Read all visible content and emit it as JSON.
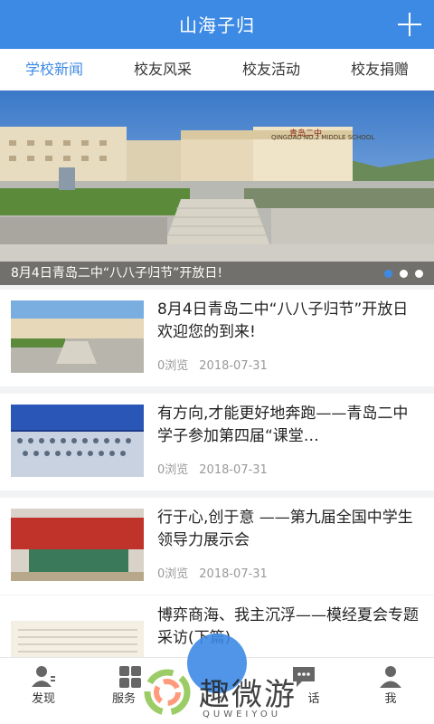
{
  "header": {
    "title": "山海子归"
  },
  "tabs": [
    {
      "label": "学校新闻"
    },
    {
      "label": "校友风采"
    },
    {
      "label": "校友活动"
    },
    {
      "label": "校友捐赠"
    }
  ],
  "banner": {
    "caption": "8月4日青岛二中“八八子归节”开放日!",
    "sign_text": "青岛二中",
    "sign_subtext": "QINGDAO NO.2 MIDDLE SCHOOL",
    "active_dot": 0
  },
  "news": [
    {
      "title": "8月4日青岛二中“八八子归节”开放日欢迎您的到来!",
      "views": "0浏览",
      "date": "2018-07-31"
    },
    {
      "title": "有方向,才能更好地奔跑——青岛二中学子参加第四届“课堂…",
      "views": "0浏览",
      "date": "2018-07-31"
    },
    {
      "title": "行于心,创于意 ——第九届全国中学生领导力展示会",
      "views": "0浏览",
      "date": "2018-07-31"
    },
    {
      "title": "博弈商海、我主沉浮——模经夏会专题采访(下篇)",
      "views": "",
      "date": ""
    }
  ],
  "nav": [
    {
      "label": "发现",
      "icon": "person-icon"
    },
    {
      "label": "服务",
      "icon": "grid-icon"
    },
    {
      "label": "",
      "icon": "center-icon"
    },
    {
      "label": "话",
      "icon": "chat-icon"
    },
    {
      "label": "我",
      "icon": "user-icon"
    }
  ],
  "watermark": {
    "text": "趣微游",
    "sub": "QUWEIYOU"
  },
  "colors": {
    "primary": "#3d8ae5",
    "background": "#f2f3f5"
  }
}
